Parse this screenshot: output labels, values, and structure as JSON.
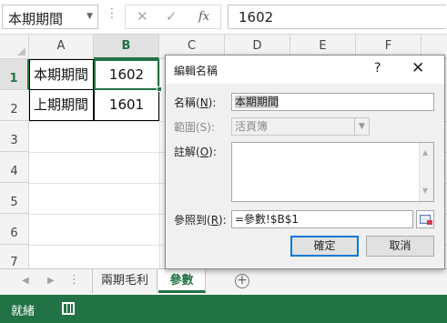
{
  "formula_bar": {
    "name_box": "本期期間",
    "value": "1602"
  },
  "grid": {
    "columns": [
      "A",
      "B",
      "C",
      "D",
      "E",
      "F"
    ],
    "rows": [
      "1",
      "2",
      "3",
      "4",
      "5",
      "6",
      "7"
    ],
    "cells": {
      "A1": "本期期間",
      "B1": "1602",
      "A2": "上期期間",
      "B2": "1601"
    }
  },
  "sheets": {
    "tabs": [
      "兩期毛利",
      "參數"
    ],
    "active": "參數"
  },
  "status_bar": {
    "label": "就緒"
  },
  "dialog": {
    "title": "編輯名稱",
    "help": "?",
    "name_label": "名稱(",
    "name_key": "N",
    "name_label_end": "):",
    "name_value": "本期期間",
    "scope_label": "範圍(S):",
    "scope_value": "活頁簿",
    "comment_label": "註解(",
    "comment_key": "O",
    "comment_label_end": "):",
    "comment_value": "",
    "refers_label": "參照到(",
    "refers_key": "R",
    "refers_label_end": "):",
    "refers_value": "=參數!$B$1",
    "ok": "確定",
    "cancel": "取消"
  }
}
